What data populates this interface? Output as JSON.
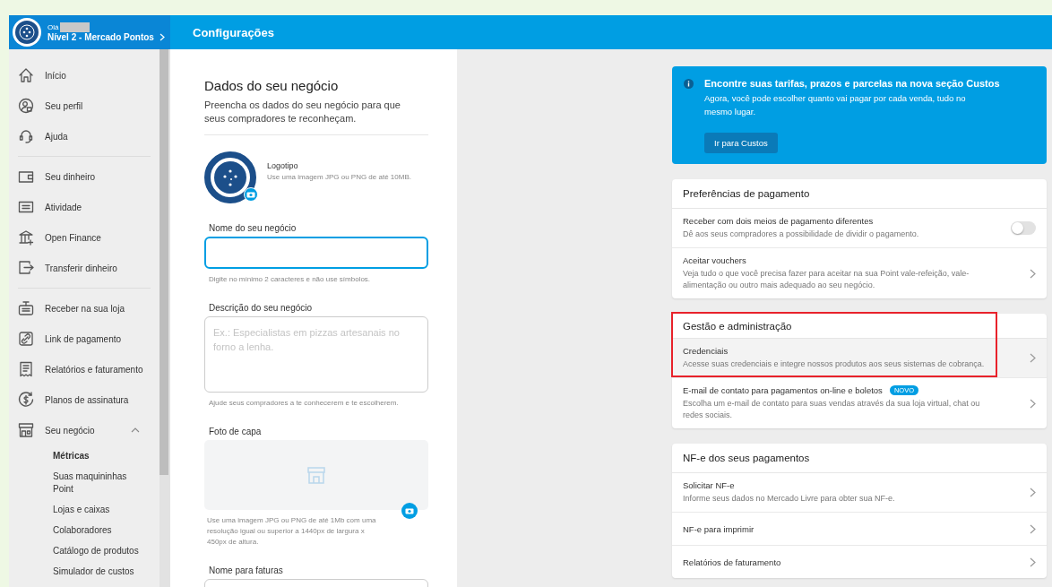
{
  "header": {
    "greeting": "Olá",
    "level_link": "Nível 2 - Mercado Pontos",
    "title": "Configurações"
  },
  "sidebar": {
    "groups": [
      {
        "items": [
          {
            "label": "Início",
            "selected": false
          },
          {
            "label": "Seu perfil",
            "selected": false
          },
          {
            "label": "Ajuda",
            "selected": false
          }
        ]
      },
      {
        "items": [
          {
            "label": "Seu dinheiro",
            "selected": false
          },
          {
            "label": "Atividade",
            "selected": false
          },
          {
            "label": "Open Finance",
            "selected": false
          },
          {
            "label": "Transferir dinheiro",
            "selected": false
          }
        ]
      },
      {
        "items": [
          {
            "label": "Receber na sua loja",
            "selected": false
          },
          {
            "label": "Link de pagamento",
            "selected": false
          },
          {
            "label": "Relatórios e faturamento",
            "selected": false
          },
          {
            "label": "Planos de assinatura",
            "selected": false
          },
          {
            "label": "Seu negócio",
            "selected": false,
            "expanded": true,
            "children": [
              {
                "label": "Métricas",
                "selected": true
              },
              {
                "label": "Suas maquininhas Point",
                "selected": false
              },
              {
                "label": "Lojas e caixas",
                "selected": false
              },
              {
                "label": "Colaboradores",
                "selected": false
              },
              {
                "label": "Catálogo de produtos",
                "selected": false
              },
              {
                "label": "Simulador de custos",
                "selected": false
              }
            ]
          }
        ]
      }
    ]
  },
  "form": {
    "title": "Dados do seu negócio",
    "subtitle": "Preencha os dados do seu negócio para que seus compradores te reconheçam.",
    "logo": {
      "label": "Logotipo",
      "hint": "Use uma imagem JPG ou PNG de até 10MB."
    },
    "fields": [
      {
        "kind": "input",
        "label": "Nome do seu negócio",
        "focused": true,
        "hint": "Digite no mínimo 2 caracteres e não use símbolos."
      },
      {
        "kind": "textarea",
        "label": "Descrição do seu negócio",
        "focused": false,
        "placeholder": "Ex.: Especialistas em pizzas artesanais no forno a lenha.",
        "hint": "Ajude seus compradores a te conhecerem e te escolherem."
      },
      {
        "kind": "image",
        "label": "Foto de capa",
        "hint": "Use uma imagem JPG ou PNG de até 1Mb com uma resolução igual ou superior a 1440px de largura x 450px de altura."
      },
      {
        "kind": "input",
        "label": "Nome para faturas"
      }
    ]
  },
  "banner": {
    "title": "Encontre suas tarifas, prazos e parcelas na nova seção Custos",
    "text": "Agora, você pode escolher quanto vai pagar por cada venda, tudo no mesmo lugar.",
    "button": "Ir para Custos"
  },
  "sections": [
    {
      "title": "Preferências de pagamento",
      "highlighted": false,
      "items": [
        {
          "kind": "toggle",
          "title": "Receber com dois meios de pagamento diferentes",
          "description": "Dê aos seus compradores a possibilidade de dividir o pagamento.",
          "on": false,
          "hovered": false
        },
        {
          "kind": "link",
          "title": "Aceitar vouchers",
          "description": "Veja tudo o que você precisa fazer para aceitar na sua Point vale-refeição, vale-alimentação ou outro mais adequado ao seu negócio.",
          "hovered": false
        }
      ]
    },
    {
      "title": "Gestão e administração",
      "highlighted": true,
      "items": [
        {
          "kind": "link",
          "title": "Credenciais",
          "description": "Acesse suas credenciais e integre nossos produtos aos seus sistemas de cobrança.",
          "hovered": true
        },
        {
          "kind": "link",
          "title": "E-mail de contato para pagamentos on-line e boletos",
          "badge": "NOVO",
          "description": "Escolha um e-mail de contato para suas vendas através da sua loja virtual, chat ou redes sociais.",
          "hovered": false
        }
      ]
    },
    {
      "title": "NF-e dos seus pagamentos",
      "highlighted": false,
      "items": [
        {
          "kind": "link",
          "title": "Solicitar NF-e",
          "description": "Informe seus dados no Mercado Livre para obter sua NF-e.",
          "hovered": false
        },
        {
          "kind": "link",
          "title": "NF-e para imprimir",
          "hovered": false
        },
        {
          "kind": "link",
          "title": "Relatórios de faturamento",
          "hovered": false
        }
      ]
    }
  ]
}
